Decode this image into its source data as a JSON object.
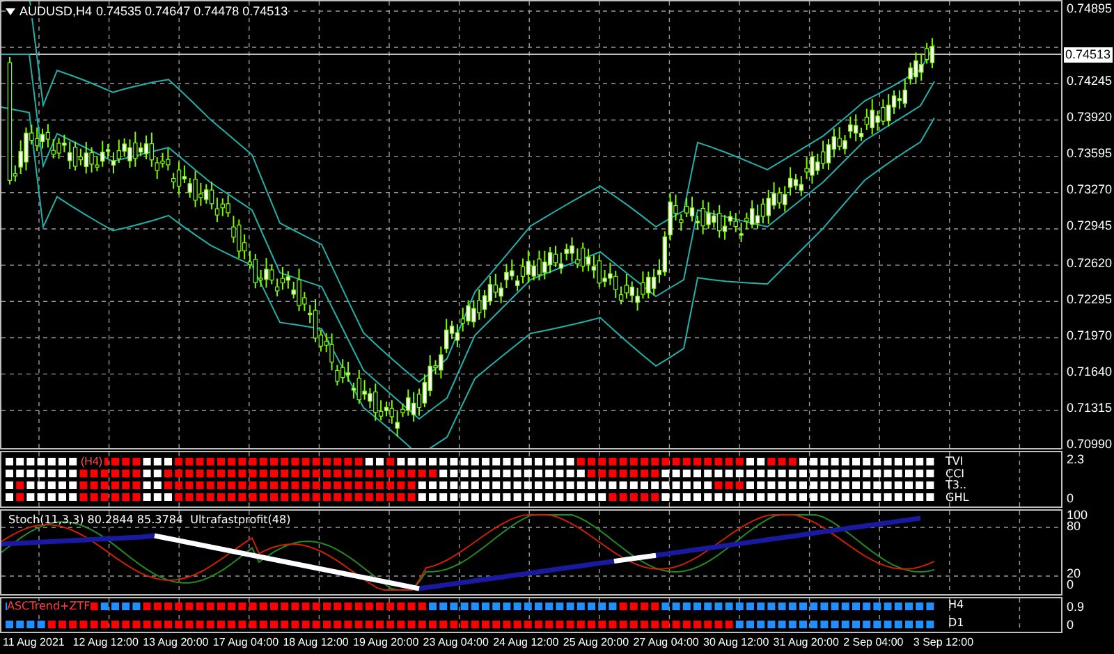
{
  "header": {
    "symbol": "AUDUSD,H4",
    "ohlc": "0.74535 0.74647 0.74478 0.74513"
  },
  "price_axis": {
    "current_price": "0.74513",
    "ticks": [
      "0.74895",
      "0.74245",
      "0.73920",
      "0.73595",
      "0.73270",
      "0.72945",
      "0.72620",
      "0.72295",
      "0.71970",
      "0.71640",
      "0.71315",
      "0.70990"
    ]
  },
  "signal_panel": {
    "title": "(H4)",
    "rows": [
      "TVI",
      "CCI",
      "T3..",
      "GHL"
    ],
    "axis": [
      "2.3",
      "0"
    ]
  },
  "stoch_panel": {
    "title": "Stoch(11,3,3) 80.2844 85.3784  Ultrafastprofit(48)",
    "axis": [
      "100",
      "80",
      "20",
      "0"
    ]
  },
  "trend_panel": {
    "title": "ASCTrend+ZTF",
    "rows": [
      "H4",
      "D1"
    ],
    "axis": [
      "0.9",
      "0"
    ]
  },
  "time_axis": [
    "11 Aug 2021",
    "12 Aug 12:00",
    "13 Aug 20:00",
    "17 Aug 04:00",
    "18 Aug 12:00",
    "19 Aug 20:00",
    "23 Aug 04:00",
    "24 Aug 12:00",
    "25 Aug 20:00",
    "27 Aug 04:00",
    "30 Aug 12:00",
    "31 Aug 20:00",
    "2 Sep 04:00",
    "3 Sep 12:00"
  ]
}
